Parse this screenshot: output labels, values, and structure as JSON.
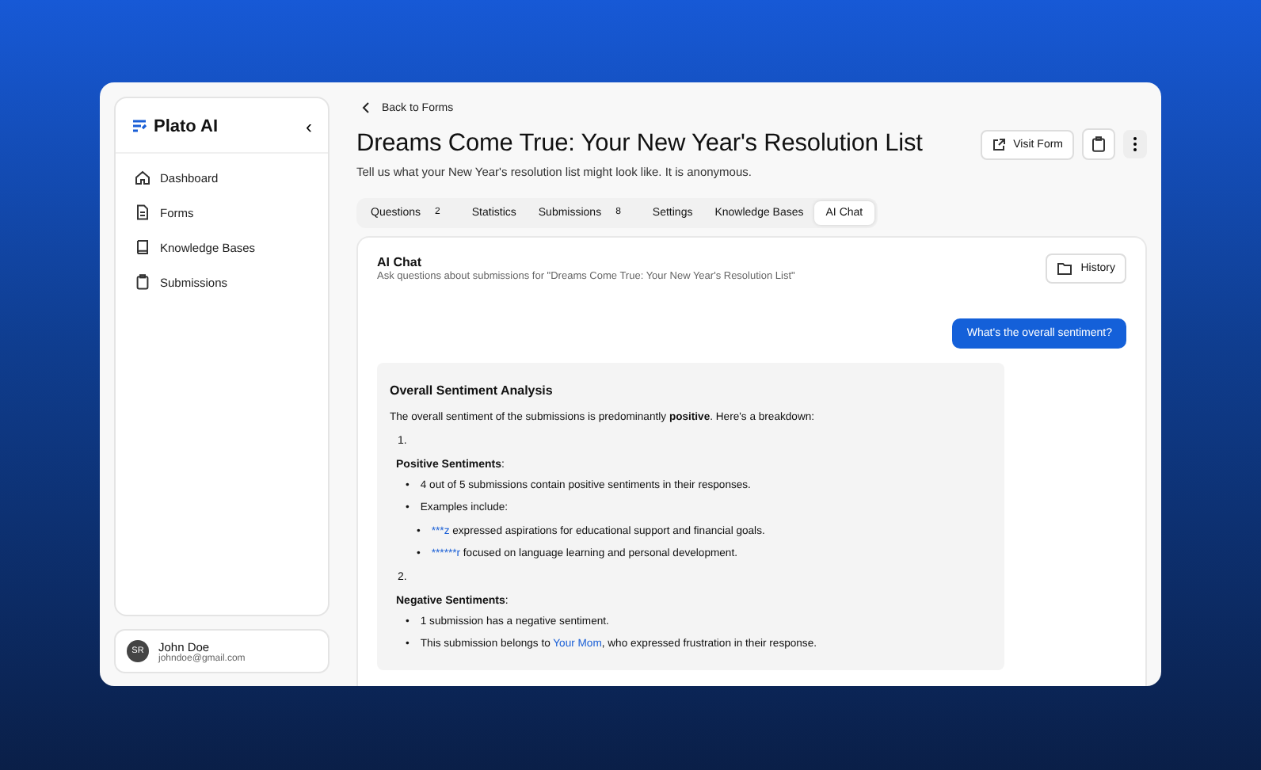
{
  "sidebar": {
    "brand": "Plato AI",
    "collapse_icon": "‹",
    "items": [
      {
        "label": "Dashboard",
        "selected": false
      },
      {
        "label": "Forms",
        "selected": false
      },
      {
        "label": "Knowledge Bases",
        "selected": false
      },
      {
        "label": "Submissions",
        "selected": false
      }
    ],
    "user": {
      "initials": "SR",
      "name": "John Doe",
      "email": "johndoe@gmail.com"
    }
  },
  "header": {
    "back": "Back to Forms",
    "title": "Dreams Come True: Your New Year's Resolution List",
    "subtitle": "Tell us what your New Year's resolution list might look like. It is anonymous.",
    "visit_button": "Visit Form"
  },
  "tabs": [
    {
      "label": "Questions",
      "count": "2",
      "selected": false
    },
    {
      "label": "Statistics",
      "selected": false
    },
    {
      "label": "Submissions",
      "count": "8",
      "selected": false
    },
    {
      "label": "Settings",
      "selected": false
    },
    {
      "label": "Knowledge Bases",
      "selected": false
    },
    {
      "label": "AI Chat",
      "selected": true
    }
  ],
  "chat": {
    "title": "AI Chat",
    "subtitle": "Ask questions about submissions for \"Dreams Come True: Your New Year's Resolution List\"",
    "history_button": "History",
    "user_message": "What's the overall sentiment?",
    "answer": {
      "heading": "Overall Sentiment Analysis",
      "intro": "The overall sentiment of the submissions is predominantly **positive**. Here's a breakdown:",
      "sections": [
        {
          "number": "1.",
          "title": "**Positive Sentiments**:",
          "bullets": [
            {
              "marker": "•",
              "before": "4 out of 5 submissions contain positive sentiments in their responses."
            },
            {
              "marker": "•",
              "before": "Examples include:",
              "children": [
                {
                  "marker": "•",
                  "link": "***z",
                  "after": " expressed aspirations for educational support and financial goals."
                },
                {
                  "marker": "•",
                  "link": "******r",
                  "after": " focused on language learning and personal development."
                }
              ]
            }
          ]
        },
        {
          "number": "2.",
          "title": "**Negative Sentiments**:",
          "bullets": [
            {
              "marker": "•",
              "before": "1 submission has a negative sentiment."
            },
            {
              "marker": "•",
              "before": "This submission belongs to ",
              "link": "Your Mom",
              "after": ", who expressed frustration in their response."
            }
          ]
        }
      ]
    }
  }
}
